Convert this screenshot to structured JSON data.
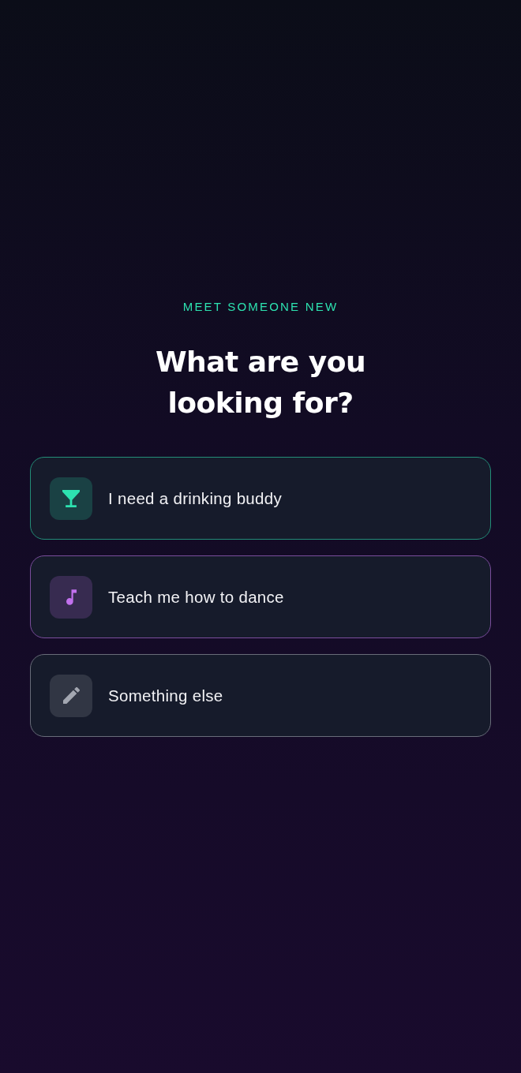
{
  "eyebrow": "MEET SOMEONE NEW",
  "heading": "What are you looking for?",
  "options": [
    {
      "kind": "drink",
      "label": "I need a drinking buddy",
      "color": "#2de2b0"
    },
    {
      "kind": "music",
      "label": "Teach me how to dance",
      "color": "#c271ee"
    },
    {
      "kind": "edit",
      "label": "Something else",
      "color": "#a3a7b1"
    }
  ]
}
